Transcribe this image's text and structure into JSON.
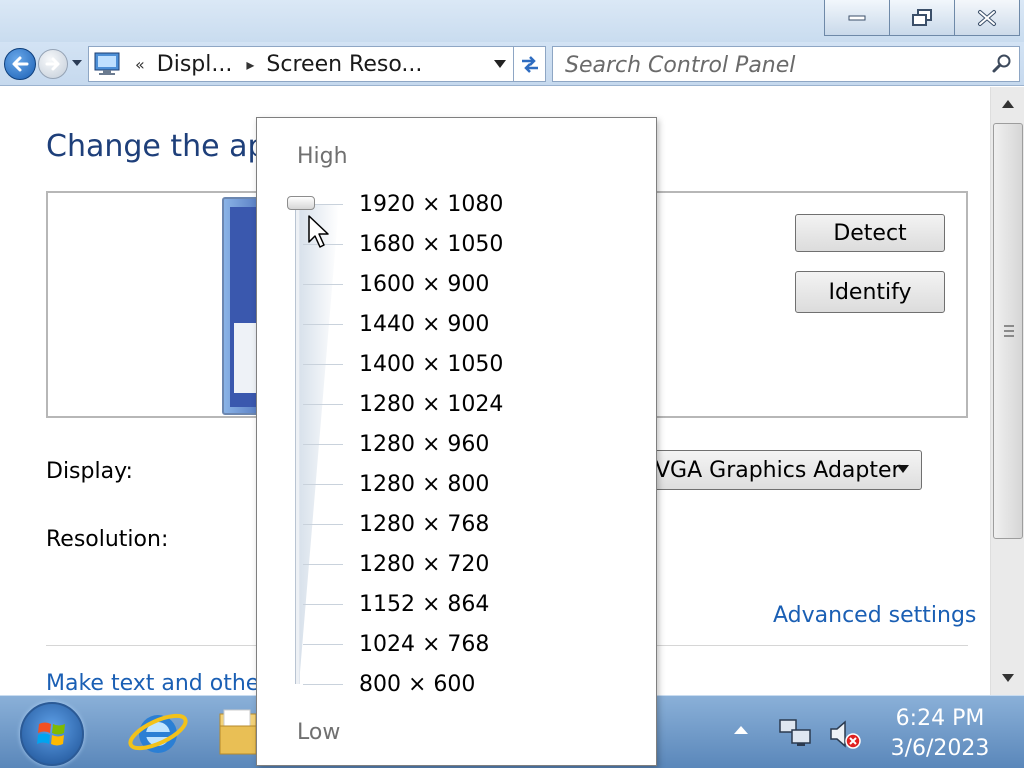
{
  "window": {
    "minimize_icon": "minimize-icon",
    "restore_icon": "restore-icon",
    "close_icon": "close-icon"
  },
  "navigation": {
    "breadcrumbs": [
      "Displ...",
      "Screen Reso..."
    ],
    "overflow_glyph": "«",
    "separator_glyph": "▸"
  },
  "search": {
    "placeholder": "Search Control Panel"
  },
  "content": {
    "page_title": "Change the ap",
    "detect_label": "Detect",
    "identify_label": "Identify",
    "display_label": "Display:",
    "display_value": "VGA Graphics Adapter",
    "resolution_label": "Resolution:",
    "advanced_link": "Advanced settings",
    "bottom_link": "Make text and othe"
  },
  "resolution_popup": {
    "high_label": "High",
    "low_label": "Low",
    "options": [
      "1920 × 1080",
      "1680 × 1050",
      "1600 × 900",
      "1440 × 900",
      "1400 × 1050",
      "1280 × 1024",
      "1280 × 960",
      "1280 × 800",
      "1280 × 768",
      "1280 × 720",
      "1152 × 864",
      "1024 × 768",
      "800 × 600"
    ],
    "selected_index": 0
  },
  "taskbar": {
    "time": "6:24 PM",
    "date": "3/6/2023"
  },
  "colors": {
    "title_blue": "#1e3f7a",
    "link_blue": "#1a5fb4",
    "muted_gray": "#707070"
  }
}
